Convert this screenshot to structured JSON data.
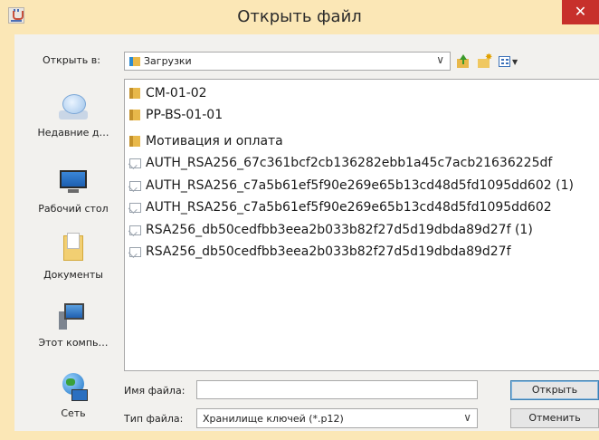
{
  "window": {
    "title": "Открыть файл",
    "close_glyph": "✕"
  },
  "toolbar": {
    "lookin_label": "Открыть в:",
    "lookin_value": "Загрузки",
    "dropdown_glyph": "∨",
    "view_dropdown_glyph": "▼",
    "icons": [
      "up-one-level-icon",
      "create-new-folder-icon",
      "view-menu-icon"
    ]
  },
  "places": [
    {
      "label": "Недавние д…",
      "icon": "recent-items-icon"
    },
    {
      "label": "Рабочий стол",
      "icon": "desktop-icon"
    },
    {
      "label": "Документы",
      "icon": "documents-icon"
    },
    {
      "label": "Этот компь…",
      "icon": "this-pc-icon"
    },
    {
      "label": "Сеть",
      "icon": "network-icon"
    }
  ],
  "files": [
    {
      "name": "CM-01-02",
      "type": "folder"
    },
    {
      "name": "PP-BS-01-01",
      "type": "folder"
    },
    {
      "name": "Мотивация и оплата",
      "type": "folder"
    },
    {
      "name": "AUTH_RSA256_67c361bcf2cb136282ebb1a45c7acb21636225df",
      "type": "file"
    },
    {
      "name": "AUTH_RSA256_c7a5b61ef5f90e269e65b13cd48d5fd1095dd602 (1)",
      "type": "file"
    },
    {
      "name": "AUTH_RSA256_c7a5b61ef5f90e269e65b13cd48d5fd1095dd602",
      "type": "file"
    },
    {
      "name": "RSA256_db50cedfbb3eea2b033b82f27d5d19dbda89d27f (1)",
      "type": "file"
    },
    {
      "name": "RSA256_db50cedfbb3eea2b033b82f27d5d19dbda89d27f",
      "type": "file"
    }
  ],
  "form": {
    "filename_label": "Имя файла:",
    "filename_value": "",
    "filetype_label": "Тип файла:",
    "filetype_value": "Хранилище ключей (*.p12)",
    "open_button": "Открыть",
    "cancel_button": "Отменить"
  },
  "colors": {
    "titlebar": "#fbe7b6",
    "close_button": "#c7302b",
    "dialog_background": "#f2f1ee",
    "folder": "#e8b84a"
  }
}
